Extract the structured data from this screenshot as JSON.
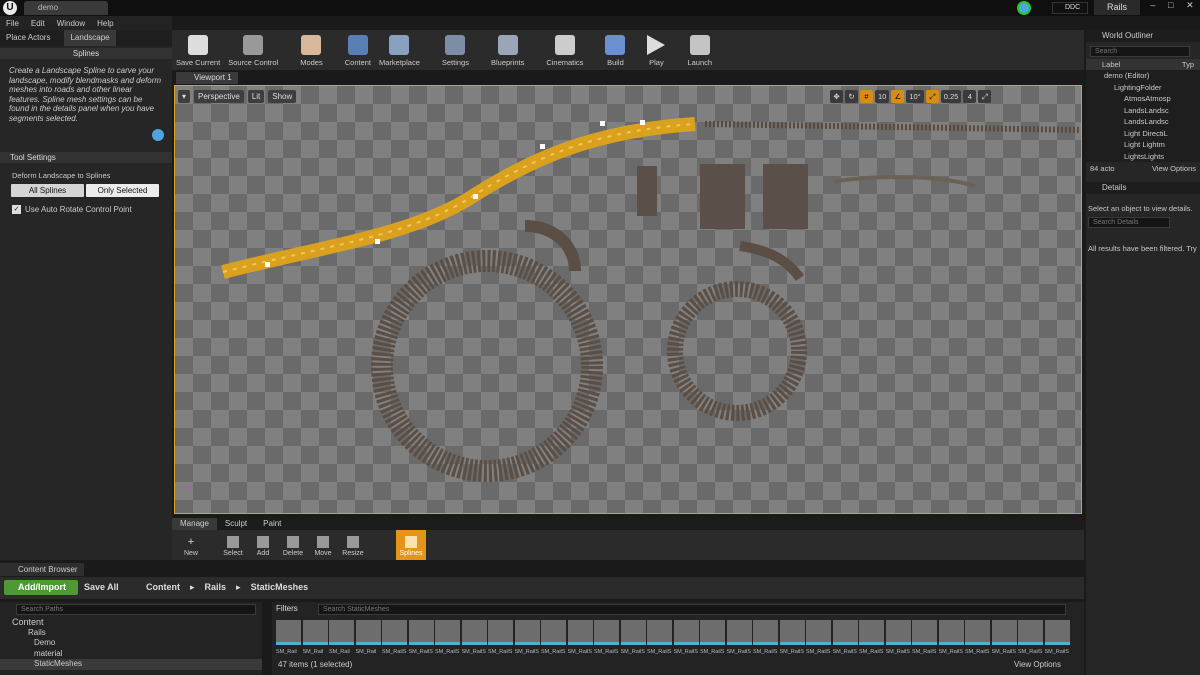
{
  "window": {
    "doc_tab": "demo",
    "project_name": "Rails",
    "ddc_label": "DDC",
    "logo": "U"
  },
  "menu": [
    "File",
    "Edit",
    "Window",
    "Help"
  ],
  "modes_tabs": [
    {
      "label": "Place Actors"
    },
    {
      "label": "Landscape"
    }
  ],
  "splines_header": "Splines",
  "splines_description": "Create a Landscape Spline to carve your landscape, modify blendmasks and deform meshes into roads and other linear features. Spline mesh settings can be found in the details panel when you have segments selected.",
  "tool_settings": {
    "header": "Tool Settings",
    "deform_label": "Deform Landscape to Splines",
    "all_splines": "All Splines",
    "only_selected": "Only Selected",
    "auto_rotate_label": "Use Auto Rotate Control Point",
    "auto_rotate_checked": true
  },
  "toolbar": [
    "Save Current",
    "Source Control",
    "Modes",
    "Content",
    "Marketplace",
    "Settings",
    "Blueprints",
    "Cinematics",
    "Build",
    "Play",
    "Launch"
  ],
  "viewport": {
    "tab": "Viewport 1",
    "perspective": "Perspective",
    "lit": "Lit",
    "show": "Show",
    "grid_snap": "10",
    "rot_snap": "10°",
    "scale_snap": "0.25",
    "cam_speed": "4"
  },
  "landscape_tabs": [
    "Manage",
    "Sculpt",
    "Paint"
  ],
  "landscape_tools": [
    "New",
    "Select",
    "Add",
    "Delete",
    "Move",
    "Resize",
    "Splines"
  ],
  "outliner": {
    "title": "World Outliner",
    "search_placeholder": "Search",
    "col_label": "Label",
    "col_type": "Typ",
    "rows": [
      "demo (Editor)",
      "LightingFolder",
      "AtmosAtmosp",
      "LandsLandsc",
      "LandsLandsc",
      "Light DirectiL",
      "Light Lightm",
      "LightsLights"
    ],
    "actor_count": "84 acto",
    "view_options": "View Options"
  },
  "details": {
    "title": "Details",
    "hint": "Select an object to view details.",
    "search_placeholder": "Search Details",
    "filtered": "All results have been filtered. Try"
  },
  "content_browser": {
    "tab": "Content Browser",
    "add_import": "Add/Import",
    "save_all": "Save All",
    "crumbs": [
      "Content",
      "Rails",
      "StaticMeshes"
    ],
    "search_paths": "Search Paths",
    "filters": "Filters",
    "search_assets": "Search StaticMeshes",
    "tree": [
      "Content",
      "Rails",
      "Demo",
      "material",
      "StaticMeshes"
    ],
    "items_status": "47 items (1 selected)",
    "view_options": "View Options",
    "asset_labels": [
      "SM_Rail",
      "SM_Rail",
      "SM_Rail",
      "SM_Rail",
      "SM_RailS",
      "SM_RailS",
      "SM_RailS",
      "SM_RailS",
      "SM_RailS",
      "SM_RailS",
      "SM_RailS",
      "SM_RailS",
      "SM_RailS",
      "SM_RailS",
      "SM_RailS",
      "SM_RailS",
      "SM_RailS",
      "SM_RailS",
      "SM_RailS",
      "SM_RailS",
      "SM_RailS",
      "SM_RailS",
      "SM_RailS",
      "SM_RailS",
      "SM_RailS",
      "SM_RailS",
      "SM_RailS",
      "SM_RailS",
      "SM_RailS",
      "SM_RailS"
    ]
  }
}
